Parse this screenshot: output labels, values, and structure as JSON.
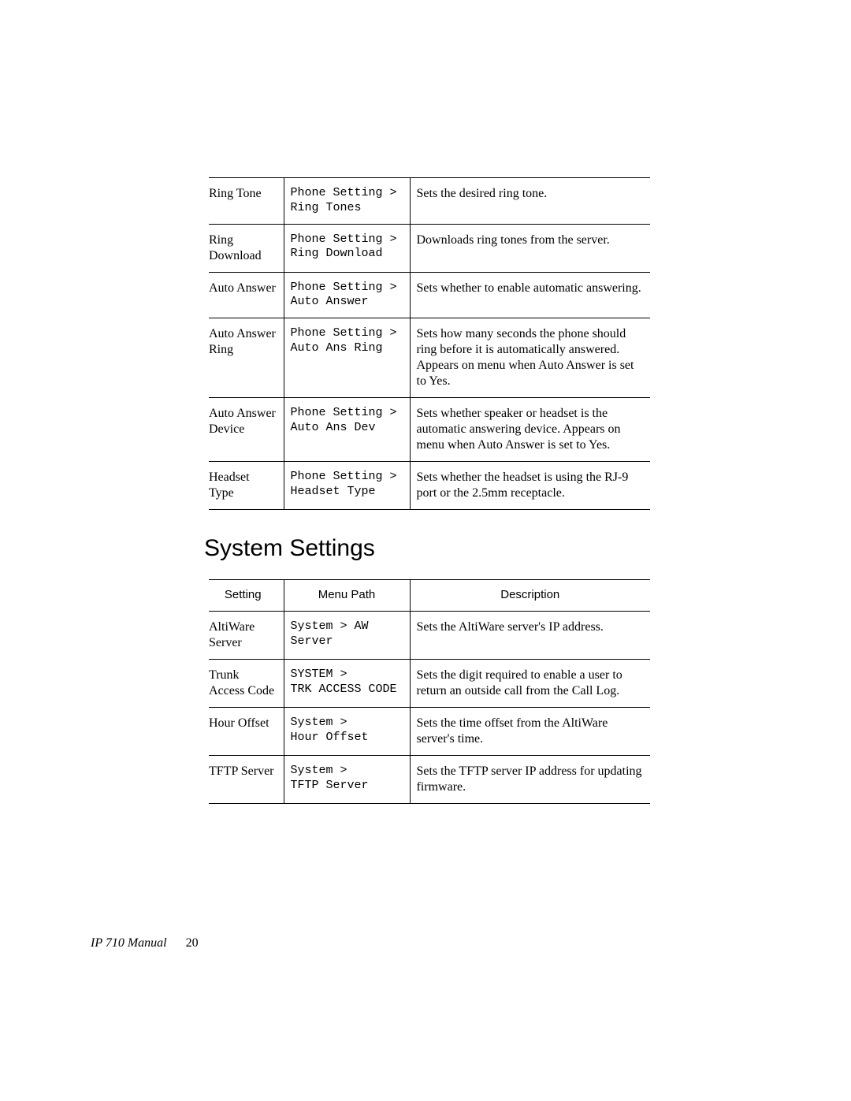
{
  "phone_settings_table": {
    "rows": [
      {
        "setting": "Ring Tone",
        "path": "Phone Setting >\nRing Tones",
        "desc": "Sets the desired ring tone."
      },
      {
        "setting": "Ring Download",
        "path": "Phone Setting >\nRing Download",
        "desc": "Downloads ring tones from the server."
      },
      {
        "setting": "Auto Answer",
        "path": "Phone Setting >\nAuto Answer",
        "desc": "Sets whether to enable automatic answering."
      },
      {
        "setting": "Auto Answer Ring",
        "path": "Phone Setting >\nAuto Ans Ring",
        "desc": "Sets how many seconds the phone should ring before it is automatically answered. Appears on menu when Auto Answer is set to Yes."
      },
      {
        "setting": "Auto Answer Device",
        "path": "Phone Setting >\nAuto Ans Dev",
        "desc": "Sets whether speaker or headset is the automatic answering device. Appears on menu when Auto Answer is set to Yes."
      },
      {
        "setting": "Headset Type",
        "path": "Phone Setting >\nHeadset Type",
        "desc": "Sets whether the headset is using the RJ-9 port or the 2.5mm receptacle."
      }
    ]
  },
  "section_heading": "System Settings",
  "system_settings_table": {
    "headers": {
      "setting": "Setting",
      "path": "Menu Path",
      "desc": "Description"
    },
    "rows": [
      {
        "setting": "AltiWare Server",
        "path": "System > AW Server",
        "desc": "Sets the AltiWare server's IP address."
      },
      {
        "setting": "Trunk Access Code",
        "path": "SYSTEM >\nTRK ACCESS CODE",
        "desc": "Sets the digit required to enable a user to return an outside call from the Call Log."
      },
      {
        "setting": "Hour Offset",
        "path": "System >\nHour Offset",
        "desc": "Sets the time offset from the AltiWare server's time."
      },
      {
        "setting": "TFTP Server",
        "path": "System >\nTFTP Server",
        "desc": "Sets the TFTP server IP address for updating firmware."
      }
    ]
  },
  "footer": {
    "title": "IP 710 Manual",
    "page_number": "20"
  }
}
